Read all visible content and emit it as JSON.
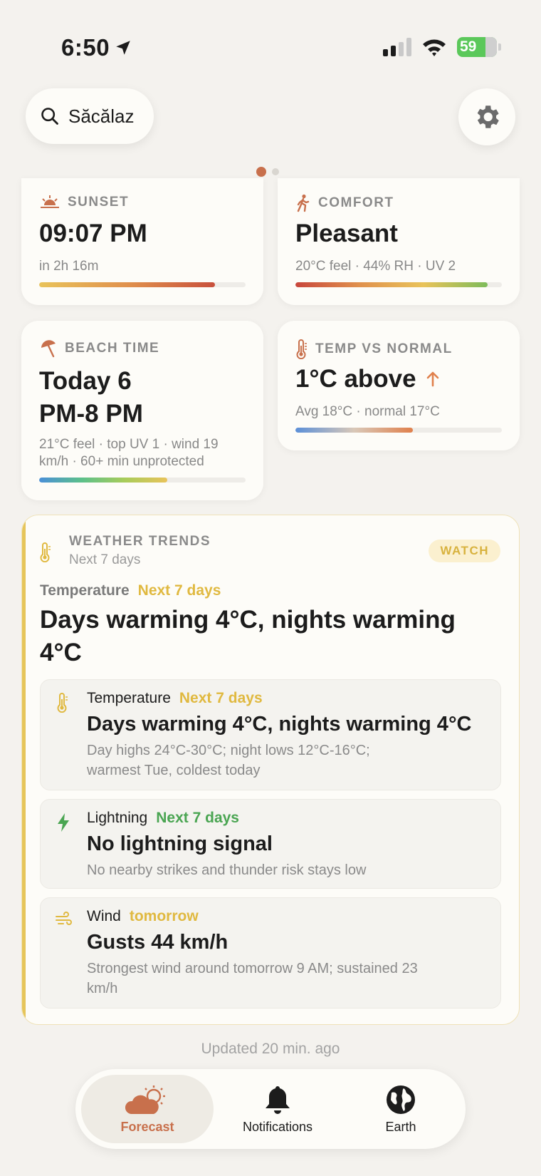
{
  "status": {
    "time": "6:50",
    "battery": "59"
  },
  "search": {
    "location": "Săcălaz"
  },
  "cards": {
    "sunset": {
      "label": "SUNSET",
      "value": "09:07 PM",
      "sub": "in 2h 16m",
      "progress": 0.85
    },
    "comfort": {
      "label": "COMFORT",
      "value": "Pleasant",
      "sub": "20°C feel · 44% RH · UV 2",
      "progress": 0.93
    },
    "beach": {
      "label": "BEACH TIME",
      "value_line1": "Today 6",
      "value_line2": "PM-8 PM",
      "sub_line1": "21°C feel · top UV 1 · wind 19",
      "sub_line2": "km/h · 60+ min unprotected",
      "progress": 0.62
    },
    "temp_normal": {
      "label": "TEMP VS NORMAL",
      "value": "1°C above",
      "sub": "Avg 18°C · normal 17°C",
      "progress": 0.57
    }
  },
  "trends": {
    "label": "WEATHER TRENDS",
    "period": "Next 7 days",
    "badge": "WATCH",
    "kicker": "Temperature",
    "kicker_period": "Next 7 days",
    "headline_line1": "Days warming 4°C, nights warming",
    "headline_line2": "4°C",
    "items": [
      {
        "title": "Temperature",
        "period": "Next 7 days",
        "period_color": "#e0b940",
        "headline": "Days warming 4°C, nights warming 4°C",
        "desc_line1": "Day highs 24°C-30°C; night lows 12°C-16°C;",
        "desc_line2": "warmest Tue, coldest today"
      },
      {
        "title": "Lightning",
        "period": "Next 7 days",
        "period_color": "#4aa552",
        "headline": "No lightning signal",
        "desc_line1": "No nearby strikes and thunder risk stays low",
        "desc_line2": ""
      },
      {
        "title": "Wind",
        "period": "tomorrow",
        "period_color": "#e0b940",
        "headline": "Gusts 44 km/h",
        "desc_line1": "Strongest wind around tomorrow 9 AM; sustained 23",
        "desc_line2": "km/h"
      }
    ]
  },
  "updated": "Updated 20 min. ago",
  "tabs": [
    {
      "label": "Forecast",
      "active": true
    },
    {
      "label": "Notifications",
      "active": false
    },
    {
      "label": "Earth",
      "active": false
    }
  ],
  "colors": {
    "accent": "#c8704c",
    "watch": "#e6c55a",
    "green": "#4aa552"
  }
}
